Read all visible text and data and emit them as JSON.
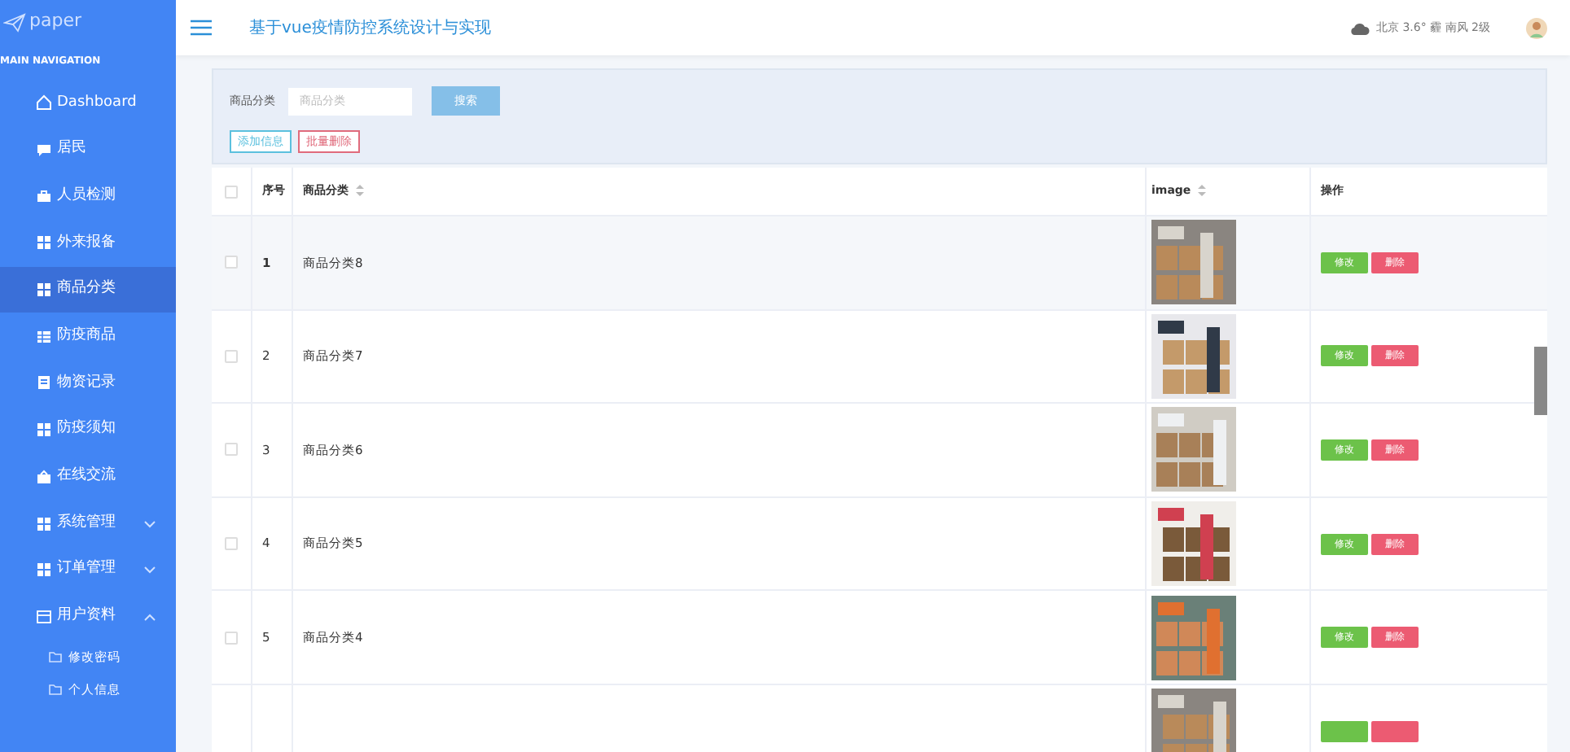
{
  "sidebar": {
    "logo": "paper",
    "section": "MAIN NAVIGATION",
    "items": [
      {
        "label": "Dashboard",
        "selected": false
      },
      {
        "label": "居民",
        "selected": false
      },
      {
        "label": "人员检测",
        "selected": false
      },
      {
        "label": "外来报备",
        "selected": false
      },
      {
        "label": "商品分类",
        "selected": true
      },
      {
        "label": "防疫商品",
        "selected": false
      },
      {
        "label": "物资记录",
        "selected": false
      },
      {
        "label": "防疫须知",
        "selected": false
      },
      {
        "label": "在线交流",
        "selected": false
      },
      {
        "label": "系统管理",
        "selected": false,
        "expanded": false
      },
      {
        "label": "订单管理",
        "selected": false,
        "expanded": false
      },
      {
        "label": "用户资料",
        "selected": false,
        "expanded": true,
        "children": [
          {
            "label": "修改密码",
            "selected": false
          },
          {
            "label": "个人信息",
            "selected": false
          }
        ]
      }
    ]
  },
  "header": {
    "title": "基于vue疫情防控系统设计与实现",
    "weather": "北京 3.6° 霾 南风 2级"
  },
  "search": {
    "label": "商品分类",
    "placeholder": "商品分类",
    "button": "搜索",
    "add_button": "添加信息",
    "batch_delete_button": "批量删除"
  },
  "table": {
    "header_checked": false,
    "columns": [
      {
        "label": "序号",
        "sortable": false
      },
      {
        "label": "商品分类",
        "sortable": true
      },
      {
        "label": "image",
        "sortable": true
      },
      {
        "label": "操作",
        "sortable": false
      }
    ],
    "rows": [
      {
        "checked": false,
        "selected": true,
        "index": "1",
        "category": "商品分类8",
        "actions": [
          {
            "kind": "edit",
            "label": "修改"
          },
          {
            "kind": "delete",
            "label": "删除"
          }
        ]
      },
      {
        "checked": false,
        "selected": false,
        "index": "2",
        "category": "商品分类7",
        "actions": [
          {
            "kind": "edit",
            "label": "修改"
          },
          {
            "kind": "delete",
            "label": "删除"
          }
        ]
      },
      {
        "checked": false,
        "selected": false,
        "index": "3",
        "category": "商品分类6",
        "actions": [
          {
            "kind": "edit",
            "label": "修改"
          },
          {
            "kind": "delete",
            "label": "删除"
          }
        ]
      },
      {
        "checked": false,
        "selected": false,
        "index": "4",
        "category": "商品分类5",
        "actions": [
          {
            "kind": "edit",
            "label": "修改"
          },
          {
            "kind": "delete",
            "label": "删除"
          }
        ]
      },
      {
        "checked": false,
        "selected": false,
        "index": "5",
        "category": "商品分类4",
        "actions": [
          {
            "kind": "edit",
            "label": "修改"
          },
          {
            "kind": "delete",
            "label": "删除"
          }
        ]
      },
      {
        "actions": [
          {
            "kind": "edit"
          },
          {
            "kind": "delete"
          }
        ]
      }
    ]
  }
}
